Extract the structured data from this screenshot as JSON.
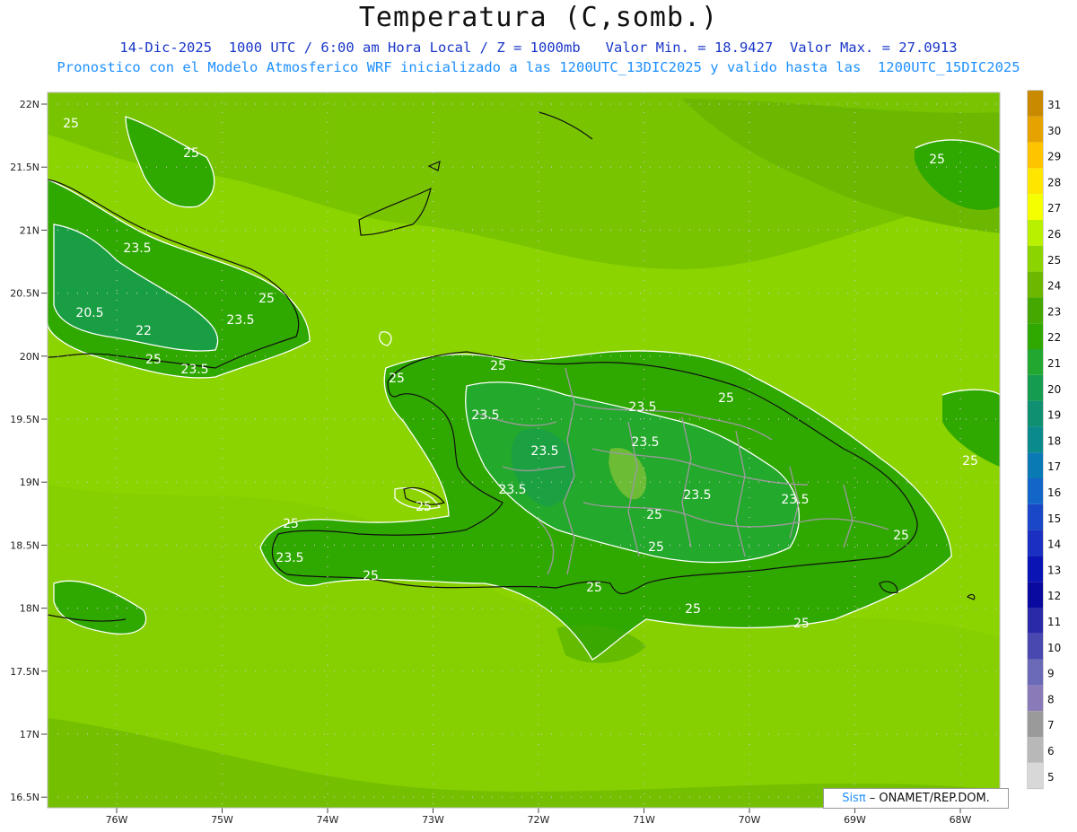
{
  "header": {
    "title": "Temperatura (C,somb.)",
    "line1": "14-Dic-2025  1000 UTC / 6:00 am Hora Local / Z = 1000mb   Valor Min. = 18.9427  Valor Max. = 27.0913",
    "line2": "Pronostico con el Modelo Atmosferico WRF inicializado a las 1200UTC_13DIC2025 y valido hasta las  1200UTC_15DIC2025"
  },
  "axes": {
    "lat_labels": [
      "22N",
      "21.5N",
      "21N",
      "20.5N",
      "20N",
      "19.5N",
      "19N",
      "18.5N",
      "18N",
      "17.5N",
      "17N",
      "16.5N"
    ],
    "lon_labels": [
      "76W",
      "75W",
      "74W",
      "73W",
      "72W",
      "71W",
      "70W",
      "69W",
      "68W"
    ]
  },
  "colorbar": {
    "levels": [
      "31",
      "30",
      "29",
      "28",
      "27",
      "26",
      "25",
      "24",
      "23",
      "22",
      "21",
      "20",
      "19",
      "18",
      "17",
      "16",
      "15",
      "14",
      "13",
      "12",
      "11",
      "10",
      "9",
      "8",
      "7",
      "6",
      "5"
    ],
    "colors": [
      "#c98a00",
      "#e6a200",
      "#ffc400",
      "#ffe600",
      "#f5ff00",
      "#b8f000",
      "#8cd400",
      "#6cb800",
      "#44a800",
      "#2fa800",
      "#22a830",
      "#169c50",
      "#0f9070",
      "#0a8a8a",
      "#0a7ab4",
      "#1266c8",
      "#1a46c8",
      "#1a30c0",
      "#0a14b4",
      "#0a0aa0",
      "#2a2aa8",
      "#4848b0",
      "#6a6ab8",
      "#8a7ab8",
      "#9a9a9a",
      "#b8b8b8",
      "#d8d8d8"
    ]
  },
  "contour_labels": [
    "25",
    "25",
    "23.5",
    "20.5",
    "22",
    "23.5",
    "25",
    "25",
    "23.5",
    "25",
    "25",
    "23.5",
    "23.5",
    "23.5",
    "23.5",
    "25",
    "25",
    "23.5",
    "23.5",
    "25",
    "23.5",
    "25",
    "25",
    "23.5",
    "25",
    "25",
    "25",
    "25",
    "25",
    "25",
    "25"
  ],
  "credit": {
    "brand": "Sisπ",
    "text": " – ONAMET/REP.DOM."
  }
}
